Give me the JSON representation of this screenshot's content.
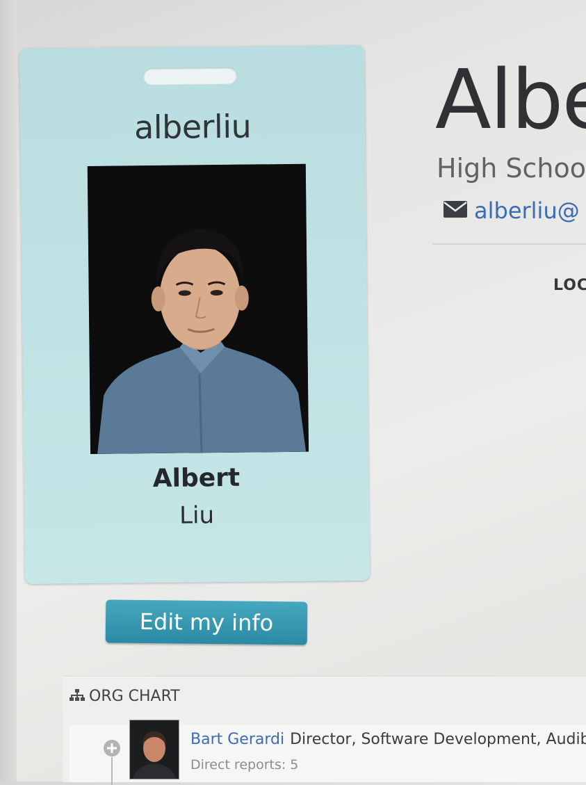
{
  "badge": {
    "username": "alberliu",
    "first_name": "Albert",
    "last_name": "Liu"
  },
  "actions": {
    "edit_label": "Edit my info"
  },
  "profile": {
    "name_partial": "Albe",
    "title_partial": "High Schoo",
    "email_partial": "alberliu@"
  },
  "sections": {
    "location_partial": "LOC"
  },
  "org_chart": {
    "title": "ORG CHART",
    "manager": {
      "name": "Bart Gerardi",
      "role": "Director, Software Development, Audib",
      "direct_reports_label": "Direct reports: 5"
    }
  },
  "colors": {
    "badge_bg": "#bfe2e4",
    "button_bg": "#2f91aa",
    "link": "#3a6bb3"
  },
  "icons": [
    "mail-icon",
    "org-chart-icon",
    "plus-circle-icon"
  ]
}
